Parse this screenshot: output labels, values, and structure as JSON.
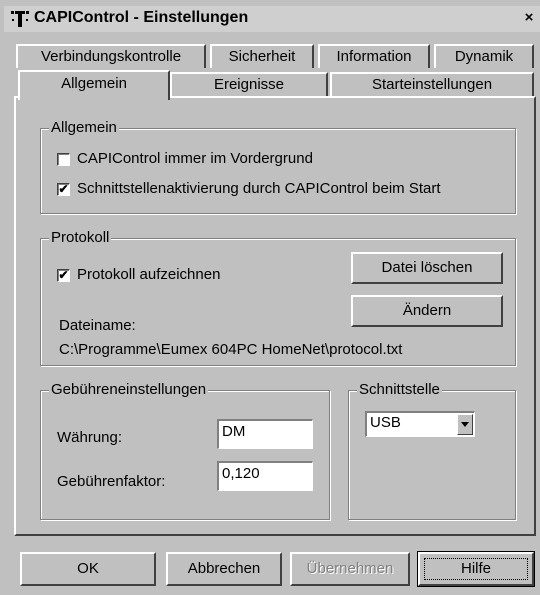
{
  "window": {
    "title": "CAPIControl - Einstellungen",
    "close_glyph": "×"
  },
  "tabs_row1": [
    "Verbindungskontrolle",
    "Sicherheit",
    "Information",
    "Dynamik"
  ],
  "tabs_row2": [
    "Allgemein",
    "Ereignisse",
    "Starteinstellungen"
  ],
  "active_tab": "Allgemein",
  "allgemein": {
    "legend": "Allgemein",
    "opt_foreground": {
      "label": "CAPIControl immer im Vordergrund",
      "checked": false
    },
    "opt_activation": {
      "label": "Schnittstellenaktivierung durch CAPIControl beim Start",
      "checked": true
    }
  },
  "protokoll": {
    "legend": "Protokoll",
    "opt_record": {
      "label": "Protokoll aufzeichnen",
      "checked": true
    },
    "delete_button": "Datei löschen",
    "change_button": "Ändern",
    "filename_label": "Dateiname:",
    "filename_value": "C:\\Programme\\Eumex 604PC HomeNet\\protocol.txt"
  },
  "gebuehren": {
    "legend": "Gebühreneinstellungen",
    "currency_label": "Währung:",
    "currency_value": "DM",
    "factor_label": "Gebührenfaktor:",
    "factor_value": "0,120"
  },
  "schnittstelle": {
    "legend": "Schnittstelle",
    "selected": "USB"
  },
  "footer": {
    "ok": "OK",
    "cancel": "Abbrechen",
    "apply": "Übernehmen",
    "help": "Hilfe"
  },
  "check_glyph": "✔",
  "icons": {
    "app": "telekom-t-icon",
    "close": "close-icon",
    "dropdown": "chevron-down-icon"
  }
}
